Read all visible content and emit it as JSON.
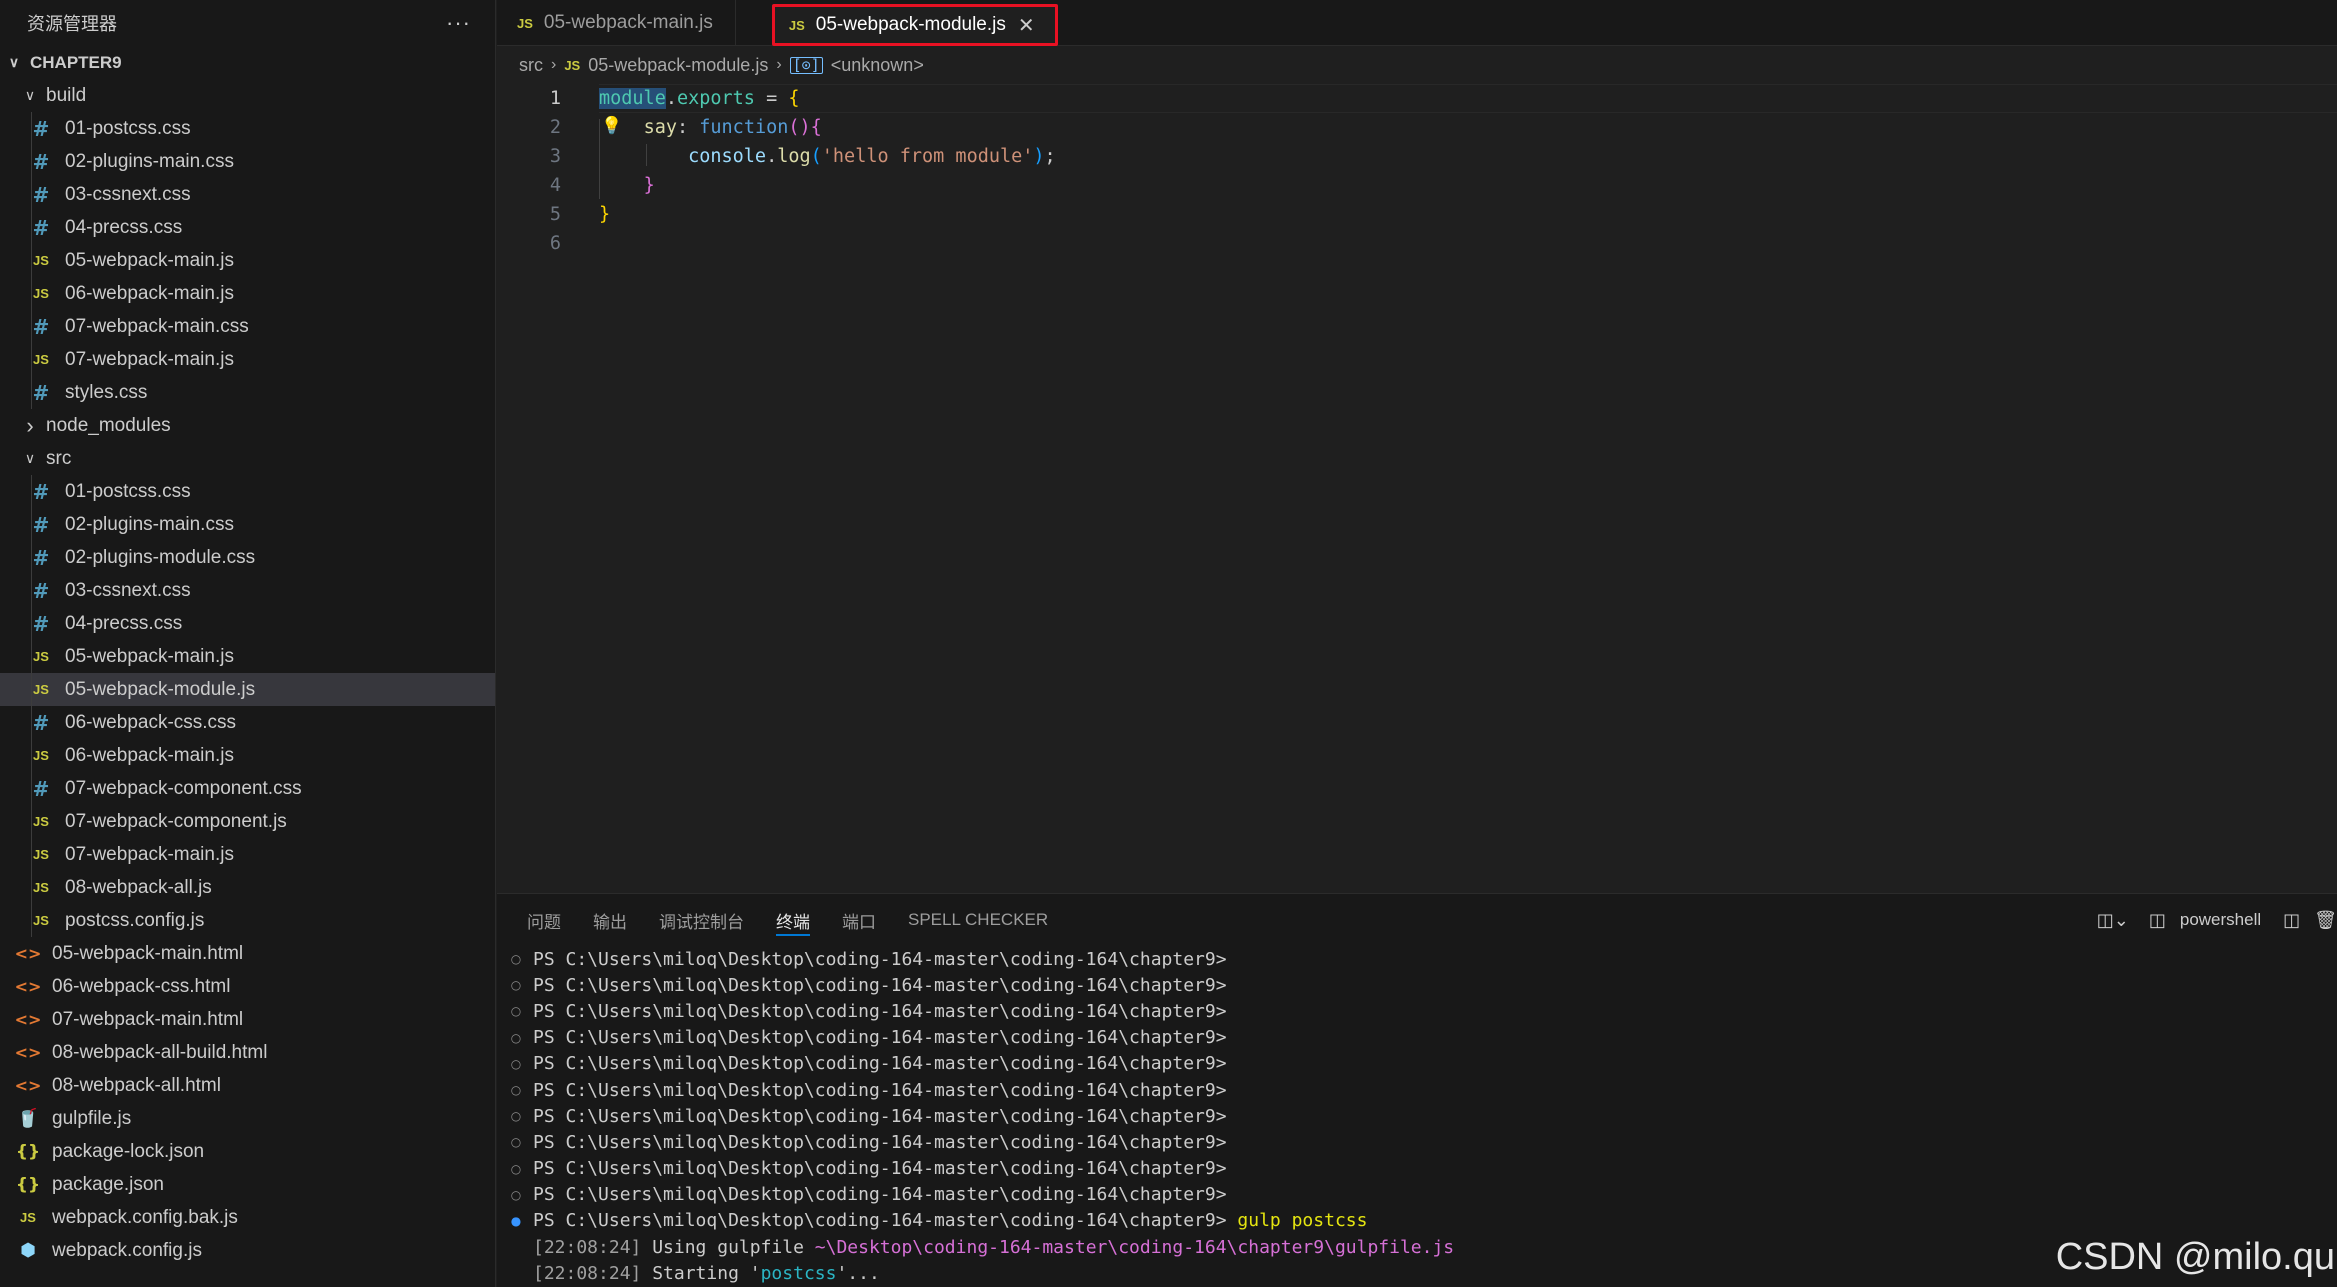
{
  "sidebar": {
    "title": "资源管理器",
    "more": "···",
    "root": "CHAPTER9",
    "build_folder": "build",
    "build_files": [
      {
        "name": "01-postcss.css",
        "icon": "css-hash-icon"
      },
      {
        "name": "02-plugins-main.css",
        "icon": "css-hash-icon"
      },
      {
        "name": "03-cssnext.css",
        "icon": "css-hash-icon"
      },
      {
        "name": "04-precss.css",
        "icon": "css-hash-icon"
      },
      {
        "name": "05-webpack-main.js",
        "icon": "js-icon"
      },
      {
        "name": "06-webpack-main.js",
        "icon": "js-icon"
      },
      {
        "name": "07-webpack-main.css",
        "icon": "css-hash-icon"
      },
      {
        "name": "07-webpack-main.js",
        "icon": "js-icon"
      },
      {
        "name": "styles.css",
        "icon": "css-hash-icon"
      }
    ],
    "node_modules": "node_modules",
    "src_folder": "src",
    "src_files": [
      {
        "name": "01-postcss.css"
      },
      {
        "name": "02-plugins-main.css"
      },
      {
        "name": "02-plugins-module.css"
      },
      {
        "name": "03-cssnext.css"
      },
      {
        "name": "04-precss.css"
      },
      {
        "name": "05-webpack-main.js"
      },
      {
        "name": "05-webpack-module.js"
      },
      {
        "name": "06-webpack-css.css"
      },
      {
        "name": "06-webpack-main.js"
      },
      {
        "name": "07-webpack-component.css"
      },
      {
        "name": "07-webpack-component.js"
      },
      {
        "name": "07-webpack-main.js"
      },
      {
        "name": "08-webpack-all.js"
      },
      {
        "name": "postcss.config.js"
      }
    ],
    "root_files": [
      {
        "name": "05-webpack-main.html"
      },
      {
        "name": "06-webpack-css.html"
      },
      {
        "name": "07-webpack-main.html"
      },
      {
        "name": "08-webpack-all-build.html"
      },
      {
        "name": "08-webpack-all.html"
      },
      {
        "name": "gulpfile.js"
      },
      {
        "name": "package-lock.json"
      },
      {
        "name": "package.json"
      },
      {
        "name": "webpack.config.bak.js"
      },
      {
        "name": "webpack.config.js"
      }
    ]
  },
  "icons": {
    "css": "#",
    "js": "JS",
    "html": "<>",
    "json": "{}",
    "gulp": "🥤",
    "webpack": "⬢",
    "chevron_down": "∨",
    "chevron_right": "›",
    "close": "✕",
    "bulb": "💡",
    "symbol": "[⊙]"
  },
  "tabs": [
    {
      "label": "05-webpack-main.js",
      "badge": "JS"
    },
    {
      "label": "05-webpack-module.js",
      "badge": "JS"
    }
  ],
  "breadcrumb": {
    "folder": "src",
    "file": "05-webpack-module.js",
    "symbol": "<unknown>"
  },
  "code": {
    "line_numbers": [
      "1",
      "2",
      "3",
      "4",
      "5",
      "6"
    ]
  },
  "panel": {
    "tabs": [
      "问题",
      "输出",
      "调试控制台",
      "终端",
      "端口",
      "SPELL CHECKER"
    ],
    "active_tab": "终端",
    "shell": "powershell",
    "prompt": "PS C:\\Users\\miloq\\Desktop\\coding-164-master\\coding-164\\chapter9>",
    "command": "gulp postcss",
    "log1_time": "[22:08:24]",
    "log1_text": " Using gulpfile ",
    "log1_path": "~\\Desktop\\coding-164-master\\coding-164\\chapter9\\gulpfile.js",
    "log2_time": "[22:08:24]",
    "log2_text": " Starting '",
    "log2_task": "postcss",
    "log2_end": "'..."
  },
  "watermark": "CSDN @milo.qu",
  "colors": {
    "accent": "#0078d4",
    "highlight_box": "#e81123",
    "selected_row": "#37373d"
  }
}
